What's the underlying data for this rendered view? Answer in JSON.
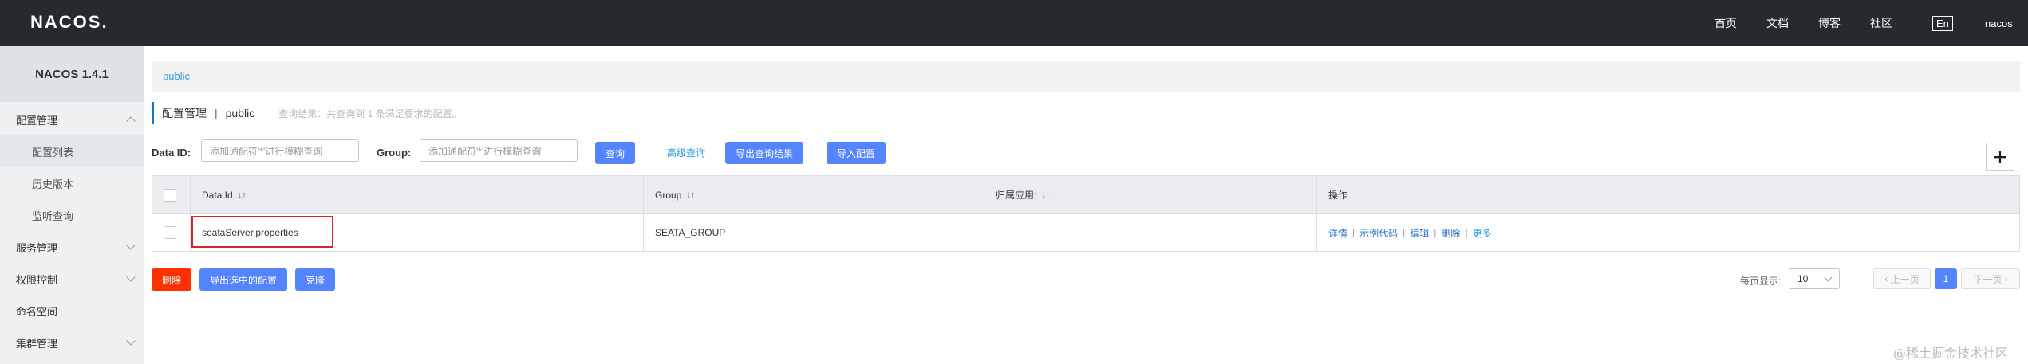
{
  "header": {
    "logo": "NACOS.",
    "nav": [
      "首页",
      "文档",
      "博客",
      "社区"
    ],
    "lang": "En",
    "user": "nacos"
  },
  "sidebar": {
    "version": "NACOS 1.4.1",
    "items": [
      {
        "label": "配置管理",
        "expanded": true
      },
      {
        "label": "配置列表",
        "sub": true,
        "active": true
      },
      {
        "label": "历史版本",
        "sub": true
      },
      {
        "label": "监听查询",
        "sub": true
      },
      {
        "label": "服务管理"
      },
      {
        "label": "权限控制"
      },
      {
        "label": "命名空间"
      },
      {
        "label": "集群管理"
      }
    ]
  },
  "breadcrumb": "public",
  "page": {
    "title": "配置管理",
    "namespace": "public",
    "hint": "查询结果：共查询到 1 条满足要求的配置。"
  },
  "filters": {
    "data_id_label": "Data ID:",
    "data_id_placeholder": "添加通配符'*'进行模糊查询",
    "group_label": "Group:",
    "group_placeholder": "添加通配符'*'进行模糊查询",
    "query_btn": "查询",
    "advanced_query": "高级查询",
    "export_btn": "导出查询结果",
    "import_btn": "导入配置"
  },
  "plus": "+",
  "table": {
    "columns": [
      "Data Id",
      "Group",
      "归属应用:",
      "操作"
    ],
    "sort_icon": "↓↑",
    "rows": [
      {
        "data_id": "seataServer.properties",
        "group": "SEATA_GROUP",
        "app": "",
        "ops": [
          "详情",
          "示例代码",
          "编辑",
          "删除",
          "更多"
        ]
      }
    ]
  },
  "bulk": {
    "delete_btn": "删除",
    "export_selected_btn": "导出选中的配置",
    "clone_btn": "克隆"
  },
  "pager": {
    "page_size_label": "每页显示:",
    "page_size": "10",
    "prev": "上一页",
    "current": "1",
    "next": "下一页"
  },
  "watermark": "@稀土掘金技术社区",
  "colors": {
    "primary": "#5584ff",
    "danger": "#ff3000",
    "topbar": "#252a2f",
    "link": "#2d9cdb"
  }
}
